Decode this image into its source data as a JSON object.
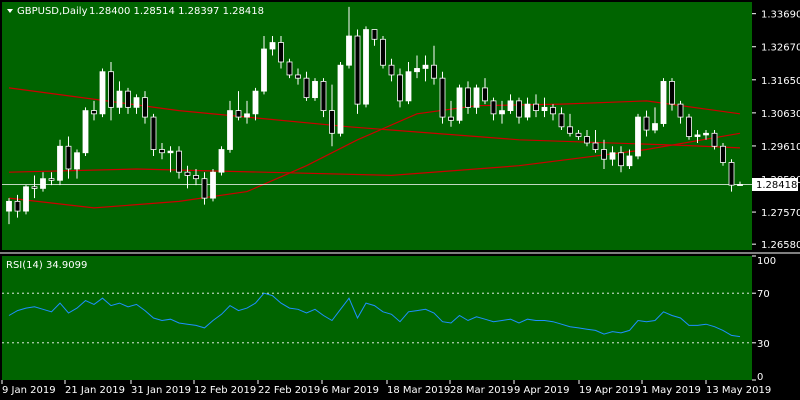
{
  "colors": {
    "background": "#006400",
    "frame": "#ffffff",
    "axis_area": "#000000",
    "bull_body": "#ffffff",
    "bear_body": "#000000",
    "wick": "#ffffff",
    "ma": "#cc0000",
    "rsi_line": "#1e90ff",
    "grid": "#ffffff",
    "price_label_bg": "#ffffff",
    "price_label_text": "#000000"
  },
  "header": {
    "symbol": "GBPUSD,Daily",
    "quote": "1.28400 1.28514 1.28397 1.28418"
  },
  "rsi_header": "RSI(14) 34.9099",
  "current_price": "1.28418",
  "chart_data": [
    {
      "type": "candlestick",
      "symbol": "GBPUSD",
      "timeframe": "Daily",
      "ylim": [
        1.264,
        1.3405
      ],
      "y_ticks": [
        "1.33690",
        "1.32670",
        "1.31650",
        "1.30630",
        "1.29610",
        "1.28590",
        "1.27570",
        "1.26580"
      ],
      "x_ticks": [
        "9 Jan 2019",
        "21 Jan 2019",
        "31 Jan 2019",
        "12 Feb 2019",
        "22 Feb 2019",
        "6 Mar 2019",
        "18 Mar 2019",
        "28 Mar 2019",
        "9 Apr 2019",
        "19 Apr 2019",
        "1 May 2019",
        "13 May 2019"
      ],
      "grid": false,
      "candles": [
        [
          1.276,
          1.28,
          1.272,
          1.279
        ],
        [
          1.279,
          1.281,
          1.274,
          1.276
        ],
        [
          1.276,
          1.284,
          1.275,
          1.2835
        ],
        [
          1.2835,
          1.287,
          1.28,
          1.283
        ],
        [
          1.283,
          1.288,
          1.282,
          1.286
        ],
        [
          1.286,
          1.288,
          1.284,
          1.2855
        ],
        [
          1.2855,
          1.298,
          1.284,
          1.296
        ],
        [
          1.296,
          1.299,
          1.286,
          1.289
        ],
        [
          1.289,
          1.295,
          1.286,
          1.294
        ],
        [
          1.294,
          1.308,
          1.293,
          1.307
        ],
        [
          1.307,
          1.31,
          1.304,
          1.306
        ],
        [
          1.306,
          1.32,
          1.305,
          1.319
        ],
        [
          1.319,
          1.322,
          1.304,
          1.308
        ],
        [
          1.308,
          1.316,
          1.306,
          1.313
        ],
        [
          1.313,
          1.314,
          1.306,
          1.308
        ],
        [
          1.308,
          1.312,
          1.306,
          1.311
        ],
        [
          1.311,
          1.313,
          1.303,
          1.305
        ],
        [
          1.305,
          1.306,
          1.293,
          1.295
        ],
        [
          1.295,
          1.297,
          1.292,
          1.294
        ],
        [
          1.294,
          1.296,
          1.288,
          1.2945
        ],
        [
          1.2945,
          1.296,
          1.286,
          1.288
        ],
        [
          1.288,
          1.29,
          1.283,
          1.287
        ],
        [
          1.287,
          1.289,
          1.284,
          1.286
        ],
        [
          1.286,
          1.288,
          1.278,
          1.28
        ],
        [
          1.28,
          1.289,
          1.279,
          1.288
        ],
        [
          1.288,
          1.296,
          1.287,
          1.295
        ],
        [
          1.295,
          1.31,
          1.294,
          1.307
        ],
        [
          1.307,
          1.313,
          1.304,
          1.305
        ],
        [
          1.305,
          1.31,
          1.303,
          1.306
        ],
        [
          1.306,
          1.314,
          1.304,
          1.313
        ],
        [
          1.313,
          1.33,
          1.312,
          1.326
        ],
        [
          1.326,
          1.33,
          1.324,
          1.328
        ],
        [
          1.328,
          1.33,
          1.32,
          1.322
        ],
        [
          1.322,
          1.323,
          1.317,
          1.318
        ],
        [
          1.318,
          1.32,
          1.315,
          1.317
        ],
        [
          1.317,
          1.319,
          1.31,
          1.311
        ],
        [
          1.311,
          1.317,
          1.31,
          1.316
        ],
        [
          1.316,
          1.317,
          1.305,
          1.307
        ],
        [
          1.307,
          1.315,
          1.296,
          1.3
        ],
        [
          1.3,
          1.322,
          1.299,
          1.321
        ],
        [
          1.321,
          1.339,
          1.32,
          1.33
        ],
        [
          1.33,
          1.332,
          1.306,
          1.309
        ],
        [
          1.309,
          1.333,
          1.308,
          1.332
        ],
        [
          1.332,
          1.332,
          1.327,
          1.329
        ],
        [
          1.329,
          1.33,
          1.32,
          1.321
        ],
        [
          1.321,
          1.323,
          1.316,
          1.318
        ],
        [
          1.318,
          1.32,
          1.308,
          1.31
        ],
        [
          1.31,
          1.322,
          1.309,
          1.319
        ],
        [
          1.319,
          1.324,
          1.317,
          1.32
        ],
        [
          1.32,
          1.324,
          1.316,
          1.321
        ],
        [
          1.321,
          1.327,
          1.315,
          1.317
        ],
        [
          1.317,
          1.319,
          1.303,
          1.305
        ],
        [
          1.305,
          1.31,
          1.302,
          1.304
        ],
        [
          1.304,
          1.315,
          1.303,
          1.314
        ],
        [
          1.314,
          1.316,
          1.306,
          1.308
        ],
        [
          1.308,
          1.315,
          1.306,
          1.314
        ],
        [
          1.314,
          1.317,
          1.309,
          1.31
        ],
        [
          1.31,
          1.311,
          1.304,
          1.306
        ],
        [
          1.306,
          1.31,
          1.303,
          1.307
        ],
        [
          1.307,
          1.312,
          1.306,
          1.31
        ],
        [
          1.31,
          1.311,
          1.303,
          1.305
        ],
        [
          1.305,
          1.311,
          1.304,
          1.309
        ],
        [
          1.309,
          1.312,
          1.305,
          1.307
        ],
        [
          1.307,
          1.311,
          1.305,
          1.308
        ],
        [
          1.308,
          1.309,
          1.304,
          1.306
        ],
        [
          1.306,
          1.308,
          1.301,
          1.302
        ],
        [
          1.302,
          1.306,
          1.299,
          1.3
        ],
        [
          1.3,
          1.301,
          1.298,
          1.299
        ],
        [
          1.299,
          1.301,
          1.296,
          1.297
        ],
        [
          1.297,
          1.301,
          1.294,
          1.295
        ],
        [
          1.295,
          1.298,
          1.289,
          1.292
        ],
        [
          1.292,
          1.296,
          1.29,
          1.294
        ],
        [
          1.294,
          1.296,
          1.288,
          1.29
        ],
        [
          1.29,
          1.295,
          1.289,
          1.293
        ],
        [
          1.293,
          1.306,
          1.292,
          1.305
        ],
        [
          1.305,
          1.307,
          1.299,
          1.301
        ],
        [
          1.301,
          1.308,
          1.3,
          1.303
        ],
        [
          1.303,
          1.317,
          1.302,
          1.316
        ],
        [
          1.316,
          1.317,
          1.307,
          1.309
        ],
        [
          1.309,
          1.31,
          1.303,
          1.305
        ],
        [
          1.305,
          1.306,
          1.298,
          1.299
        ],
        [
          1.299,
          1.301,
          1.297,
          1.2995
        ],
        [
          1.2995,
          1.301,
          1.298,
          1.3
        ],
        [
          1.3,
          1.301,
          1.295,
          1.296
        ],
        [
          1.296,
          1.297,
          1.29,
          1.291
        ],
        [
          1.291,
          1.292,
          1.282,
          1.284
        ],
        [
          1.284,
          1.2851,
          1.284,
          1.2842
        ]
      ],
      "moving_averages": [
        {
          "points": [
            [
              0,
              1.314
            ],
            [
              20,
              1.307
            ],
            [
              40,
              1.302
            ],
            [
              60,
              1.298
            ],
            [
              80,
              1.2962
            ],
            [
              86,
              1.2955
            ]
          ]
        },
        {
          "points": [
            [
              0,
              1.288
            ],
            [
              15,
              1.289
            ],
            [
              30,
              1.288
            ],
            [
              45,
              1.287
            ],
            [
              60,
              1.29
            ],
            [
              75,
              1.295
            ],
            [
              86,
              1.3
            ]
          ]
        },
        {
          "points": [
            [
              0,
              1.28
            ],
            [
              10,
              1.277
            ],
            [
              20,
              1.279
            ],
            [
              28,
              1.282
            ],
            [
              35,
              1.29
            ],
            [
              41,
              1.298
            ],
            [
              48,
              1.306
            ],
            [
              55,
              1.3085
            ],
            [
              65,
              1.309
            ],
            [
              75,
              1.31
            ],
            [
              86,
              1.306
            ]
          ]
        }
      ]
    },
    {
      "type": "line",
      "name": "RSI(14)",
      "ylim": [
        0,
        100
      ],
      "y_ticks": [
        "100",
        "70",
        "30",
        "0"
      ],
      "levels": [
        70,
        30
      ],
      "values": [
        52,
        56,
        58,
        59,
        57,
        55,
        62,
        54,
        58,
        64,
        61,
        66,
        60,
        62,
        59,
        61,
        56,
        50,
        48,
        49,
        46,
        45,
        44,
        42,
        48,
        53,
        60,
        56,
        58,
        62,
        70,
        68,
        62,
        58,
        57,
        54,
        57,
        52,
        48,
        57,
        66,
        50,
        62,
        60,
        55,
        53,
        47,
        55,
        56,
        57,
        54,
        47,
        46,
        52,
        48,
        51,
        49,
        47,
        48,
        49,
        46,
        49,
        48,
        48,
        47,
        45,
        43,
        42,
        41,
        40,
        37,
        39,
        38,
        40,
        48,
        47,
        48,
        55,
        52,
        50,
        44,
        44,
        45,
        43,
        40,
        36,
        35
      ]
    }
  ]
}
